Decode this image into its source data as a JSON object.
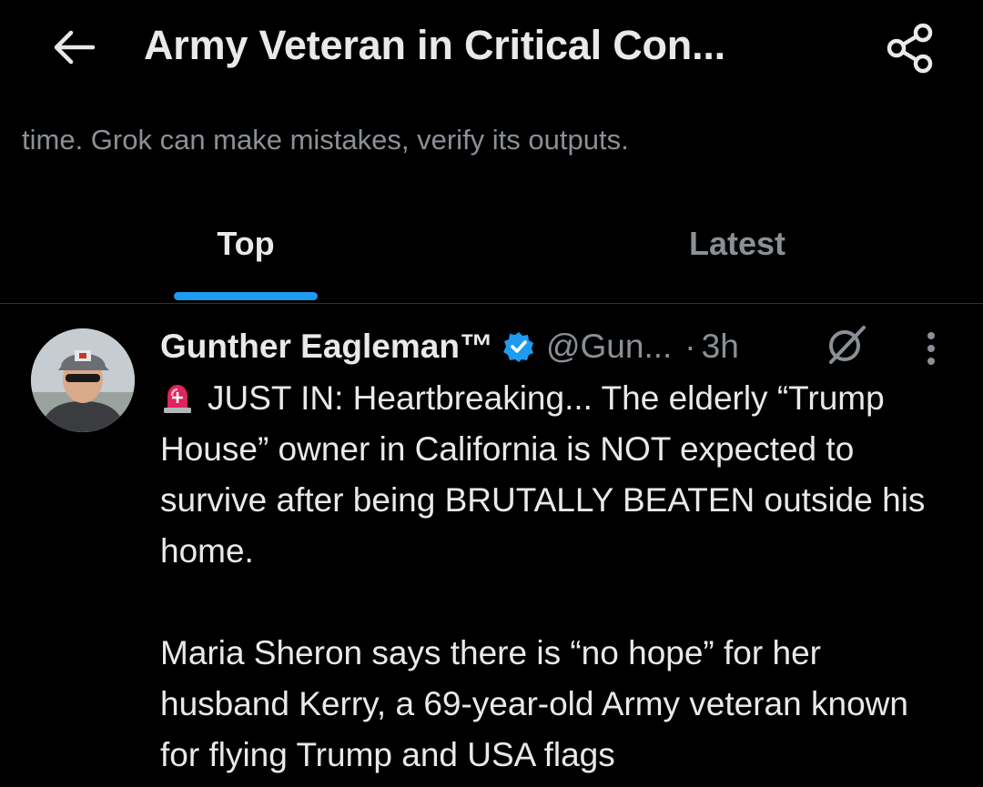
{
  "header": {
    "title": "Army Veteran in Critical Con...",
    "back_icon": "arrow-left-icon",
    "share_icon": "share-icon"
  },
  "disclaimer": "time. Grok can make mistakes, verify its outputs.",
  "tabs": [
    {
      "label": "Top",
      "selected": true
    },
    {
      "label": "Latest",
      "selected": false
    }
  ],
  "tweet": {
    "author_name": "Gunther Eagleman™",
    "verified": true,
    "handle": "@Gun...",
    "separator": "·",
    "time": "3h",
    "line1_emoji": "siren-icon",
    "paragraph1": "JUST IN: Heartbreaking... The elderly “Trump House” owner in California is NOT expected to survive after being BRUTALLY BEATEN outside his home.",
    "paragraph2": "Maria Sheron says there is “no hope” for her husband Kerry, a 69-year-old Army veteran known for flying Trump and USA flags"
  },
  "colors": {
    "background": "#000000",
    "primary_text": "#e7e9ea",
    "secondary_text": "#8b9096",
    "accent": "#1d9bf0",
    "divider": "#2f3336"
  }
}
